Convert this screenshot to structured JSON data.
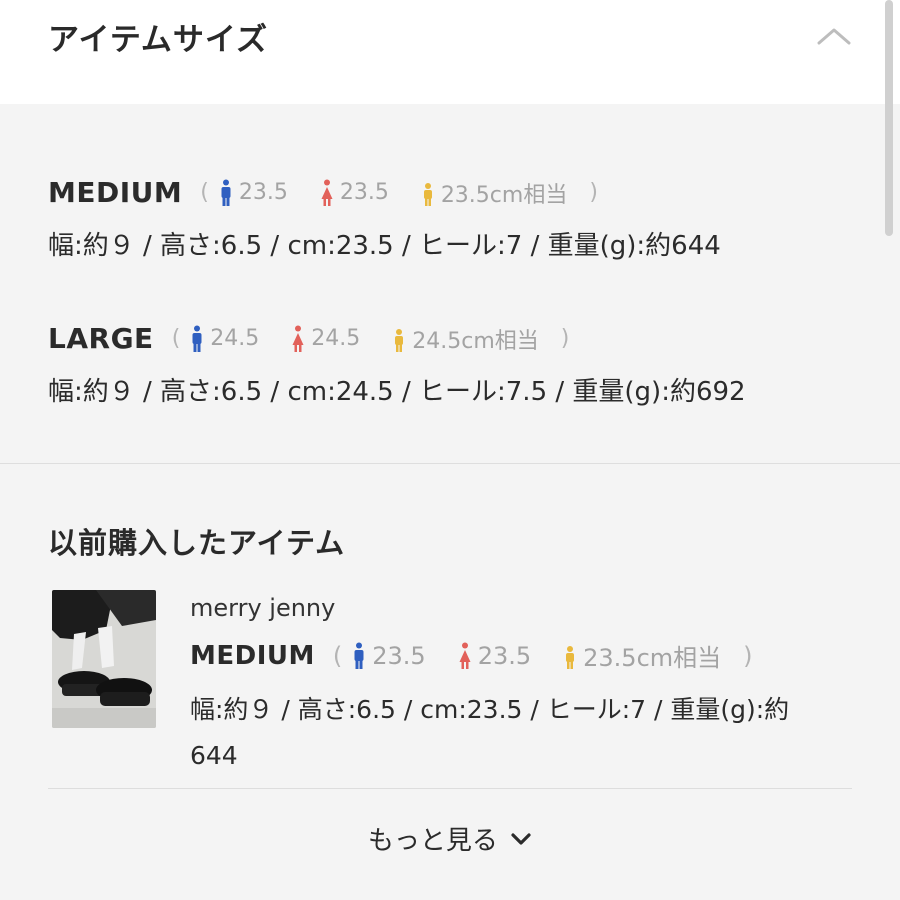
{
  "header": {
    "title": "アイテムサイズ"
  },
  "sizes": [
    {
      "name": "MEDIUM",
      "open_paren": "(",
      "men": "23.5",
      "women": "23.5",
      "kids": "23.5cm相当",
      "close_paren": ")",
      "details": "幅:約９ / 高さ:6.5 / cm:23.5 / ヒール:7 / 重量(g):約644"
    },
    {
      "name": "LARGE",
      "open_paren": "(",
      "men": "24.5",
      "women": "24.5",
      "kids": "24.5cm相当",
      "close_paren": ")",
      "details": "幅:約９ / 高さ:6.5 / cm:24.5 / ヒール:7.5 / 重量(g):約692"
    }
  ],
  "purchased": {
    "title": "以前購入したアイテム",
    "item": {
      "brand": "merry jenny",
      "size_name": "MEDIUM",
      "open_paren": "(",
      "men": "23.5",
      "women": "23.5",
      "kids": "23.5cm相当",
      "close_paren": ")",
      "details": "幅:約９ / 高さ:6.5 / cm:23.5 / ヒール:7 / 重量(g):約644"
    }
  },
  "more_label": "もっと見る",
  "icons": {
    "collapse": "chevron-up-icon",
    "more": "chevron-down-icon",
    "men": "man-icon",
    "women": "woman-icon",
    "kids": "child-icon"
  },
  "colors": {
    "men_icon": "#2f5fc0",
    "women_icon": "#e2615a",
    "kids_icon": "#e9b93d",
    "fit_text": "#a3a3a3"
  }
}
